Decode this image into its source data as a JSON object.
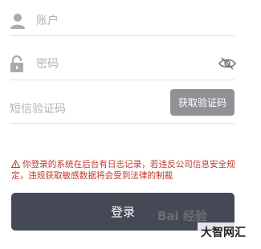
{
  "form": {
    "account_placeholder": "账户",
    "password_placeholder": "密码",
    "sms_placeholder": "短信验证码",
    "sms_button_label": "获取验证码",
    "notice_text": "你登录的系统在后台有日志记录，若违反公司信息安全规定，违规获取敏感数据将会受到法律的制裁",
    "login_button_label": "登录"
  },
  "icons": {
    "account": "user-icon",
    "password": "lock-icon",
    "toggle_password": "eye-slash-icon",
    "warning": "warning-icon"
  },
  "colors": {
    "icon_gray": "#aaaaaa",
    "divider": "#e2e2e2",
    "sms_button_bg": "#8f9195",
    "login_button_bg": "#444955",
    "notice_red": "#c0392b"
  },
  "watermark": {
    "text": "Bai 经验",
    "site_logo": "大智网汇"
  }
}
